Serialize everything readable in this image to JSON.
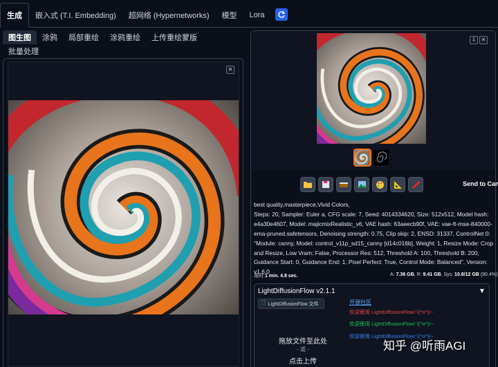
{
  "top_tabs": [
    "生成",
    "嵌入式 (T.I. Embedding)",
    "超网络 (Hypernetworks)",
    "模型",
    "Lora"
  ],
  "sub_tabs": [
    "图生图",
    "涂鸦",
    "局部重绘",
    "涂鸦重绘",
    "上传重绘蒙版",
    "批量处理"
  ],
  "right": {
    "send_to": "Send to CanvasEdito",
    "params": [
      "best quality,masterpiece,Vivid Colors,",
      "Steps: 20, Sampler: Euler a, CFG scale: 7, Seed: 4014334620, Size: 512x512, Model hash: e4a30e4607, Model: majicmixRealistic_v6, VAE hash: 63aeecb90f, VAE: vae-ft-mse-840000-ema-pruned.safetensors, Denoising strength: 0.75, Clip skip: 2, ENSD: 31337, ControlNet 0: \"Module: canny, Model: control_v11p_sd15_canny [d14c016b], Weight: 1, Resize Mode: Crop and Resize, Low Vram: False, Processor Res: 512, Threshold A: 100, Threshold B: 200, Guidance Start: 0, Guidance End: 1, Pixel Perfect: True, Control Mode: Balanced\", Version: v1.6.0"
    ],
    "time_label": "用时:",
    "time_value": "1 min. 4.8 sec.",
    "vram_a_label": "A:",
    "vram_a_value": "7.36 GB",
    "vram_r_label": ", R:",
    "vram_r_value": "9.41 GB",
    "vram_sys_label": ", Sys:",
    "vram_sys_value": "10.8/12 GB",
    "vram_pct": "(90.4%)"
  },
  "ldf": {
    "title": "LightDiffusionFlow v2.1.1",
    "file_button": "LightDiffusionFlow 文件",
    "drop_line1": "拖放文件至此处",
    "drop_line2": "- 或 -",
    "drop_line3": "点击上传",
    "community_link": "开源社区",
    "welcome_1": "欢迎使用 LightDiffusionFlow! \\(^o^)/~",
    "welcome_2": "欢迎使用 LightDiffusionFlow! \\(^o^)/~",
    "welcome_3": "欢迎使用 LightDiffusionFlow! \\(^o^)/~",
    "welcome_colors": [
      "#ef4444",
      "#22c55e",
      "#3b82f6"
    ]
  },
  "watermark": "知乎 @听雨AGI",
  "icons": [
    "folder-icon",
    "save-icon",
    "zip-icon",
    "image-icon",
    "palette-icon",
    "ruler-icon",
    "extras-icon"
  ],
  "colors": {
    "accent": "#2563eb",
    "selected_thumb": "#f97316",
    "background": "#0b0f19"
  }
}
